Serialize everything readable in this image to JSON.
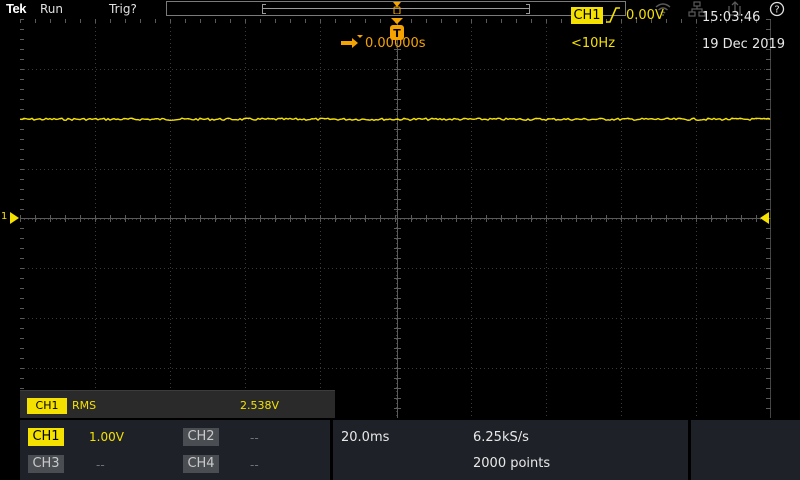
{
  "topbar": {
    "brand": "Tek",
    "acq_state": "Run",
    "trigger_state": "Trig?",
    "icons": [
      "wifi-icon",
      "network-icon",
      "export-icon",
      "help-icon"
    ],
    "help_label": "?"
  },
  "display": {
    "channel_marker_label": "1",
    "trigger_marker_label": "T"
  },
  "measurement": {
    "source": "CH1",
    "name": "RMS",
    "value": "2.538V"
  },
  "vertical": {
    "ch1": {
      "label": "CH1",
      "scale": "1.00V",
      "active": true
    },
    "ch2": {
      "label": "CH2",
      "scale": "--",
      "active": false
    },
    "ch3": {
      "label": "CH3",
      "scale": "--",
      "active": false
    },
    "ch4": {
      "label": "CH4",
      "scale": "--",
      "active": false
    }
  },
  "horizontal": {
    "time_per_div": "20.0ms",
    "sample_rate": "6.25kS/s",
    "delay": "0.00000s",
    "record_length": "2000 points"
  },
  "trigger": {
    "source": "CH1",
    "slope": "rising",
    "level": "0.00V",
    "frequency": "<10Hz"
  },
  "clock": {
    "time": "15:03:46",
    "date": "19 Dec 2019"
  },
  "colors": {
    "ch1": "#f5e100",
    "delay": "#f5a300",
    "panel": "#1e2228"
  }
}
